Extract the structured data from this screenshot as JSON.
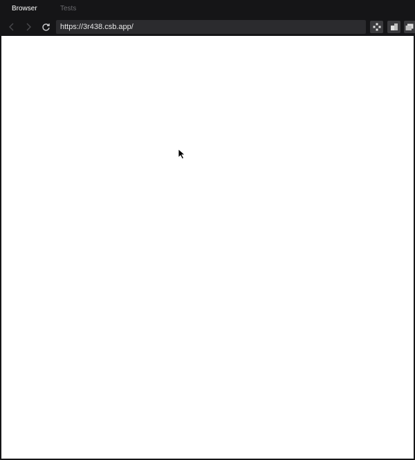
{
  "tabs": [
    {
      "label": "Browser",
      "active": true
    },
    {
      "label": "Tests",
      "active": false
    }
  ],
  "toolbar": {
    "url": "https://3r438.csb.app/"
  },
  "icons": {
    "back": "chevron-left-icon",
    "forward": "chevron-right-icon",
    "reload": "reload-icon",
    "tool1": "gamepad-icon",
    "tool2": "cubes-icon",
    "tool3": "window-icon"
  },
  "colors": {
    "chrome_background": "#151517",
    "address_bar": "#2b2b2e",
    "active_tab_text": "#ffffff",
    "inactive_tab_text": "#6b6b6f",
    "viewport": "#ffffff"
  }
}
